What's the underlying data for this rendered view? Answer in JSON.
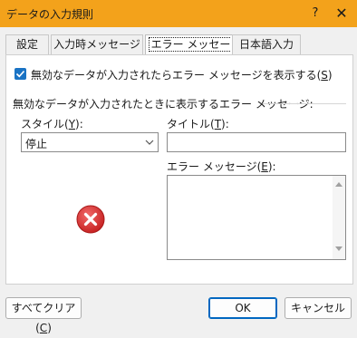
{
  "window": {
    "title": "データの入力規則",
    "help_label": "?",
    "close_label": "✕"
  },
  "tabs": [
    {
      "label": "設定"
    },
    {
      "label": "入力時メッセージ"
    },
    {
      "label": "エラー メッセージ",
      "active": true
    },
    {
      "label": "日本語入力"
    }
  ],
  "show_error": {
    "checked": true,
    "label_pre": "無効なデータが入力されたらエラー メッセージを表示する(",
    "label_key": "S",
    "label_post": ")"
  },
  "section_title": "無効なデータが入力されたときに表示するエラー メッセージ:",
  "style_field": {
    "label_pre": "スタイル(",
    "label_key": "Y",
    "label_post": "):",
    "value": "停止"
  },
  "title_field": {
    "label_pre": "タイトル(",
    "label_key": "T",
    "label_post": "):",
    "value": ""
  },
  "message_field": {
    "label_pre": "エラー メッセージ(",
    "label_key": "E",
    "label_post": "):",
    "value": ""
  },
  "icons": {
    "stop": "error-stop-icon",
    "accent": "#1a73c4",
    "error_red": "#d92b2b",
    "titlebar": "#f3a21b"
  },
  "buttons": {
    "clear_pre": "すべてクリア(",
    "clear_key": "C",
    "clear_post": ")",
    "ok": "OK",
    "cancel": "キャンセル"
  }
}
